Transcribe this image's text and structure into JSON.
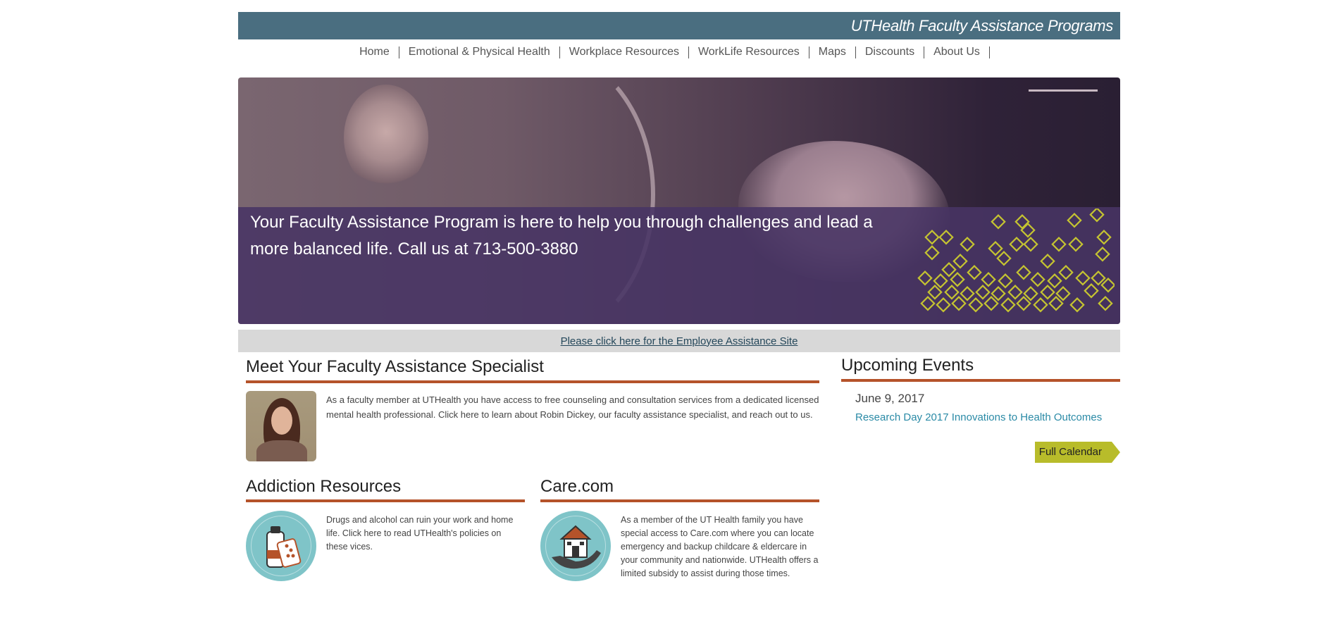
{
  "header": {
    "site_title": "UTHealth Faculty Assistance Programs"
  },
  "nav": {
    "items": [
      {
        "label": "Home"
      },
      {
        "label": "Emotional & Physical Health"
      },
      {
        "label": "Workplace Resources"
      },
      {
        "label": "WorkLife Resources"
      },
      {
        "label": "Maps"
      },
      {
        "label": "Discounts"
      },
      {
        "label": "About Us"
      }
    ]
  },
  "hero": {
    "caption": "Your Faculty Assistance Program is here to help you through challenges and lead a more balanced life. Call us at 713-500-3880"
  },
  "employee_assistance_link": "Please click here for the Employee Assistance Site",
  "meet": {
    "title": "Meet Your Faculty Assistance Specialist",
    "body": "As a faculty member at UTHealth you have access to free counseling and consultation services from a dedicated licensed mental health professional. Click here to learn about Robin Dickey, our faculty assistance specialist, and reach out to us."
  },
  "addiction": {
    "title": "Addiction Resources",
    "body": "Drugs and alcohol can ruin your work and home life. Click here to read UTHealth's policies on these vices."
  },
  "care": {
    "title": "Care.com",
    "body": "As a member of the UT Health family you have special access to Care.com where you can locate emergency and backup childcare & eldercare in your community and nationwide. UTHealth offers a limited subsidy to assist during those times."
  },
  "events": {
    "title": "Upcoming Events",
    "items": [
      {
        "date": "June 9, 2017",
        "title": "Research Day 2017 Innovations to Health Outcomes"
      }
    ],
    "full_calendar_label": "Full Calendar"
  },
  "colors": {
    "header_bar": "#4a6e80",
    "section_rule": "#b5532a",
    "link": "#2a8aa6",
    "calendar_button": "#b8bc2a",
    "hero_band": "#483464",
    "diamond": "#c5c431",
    "icon_circle": "#7fc4c8"
  }
}
